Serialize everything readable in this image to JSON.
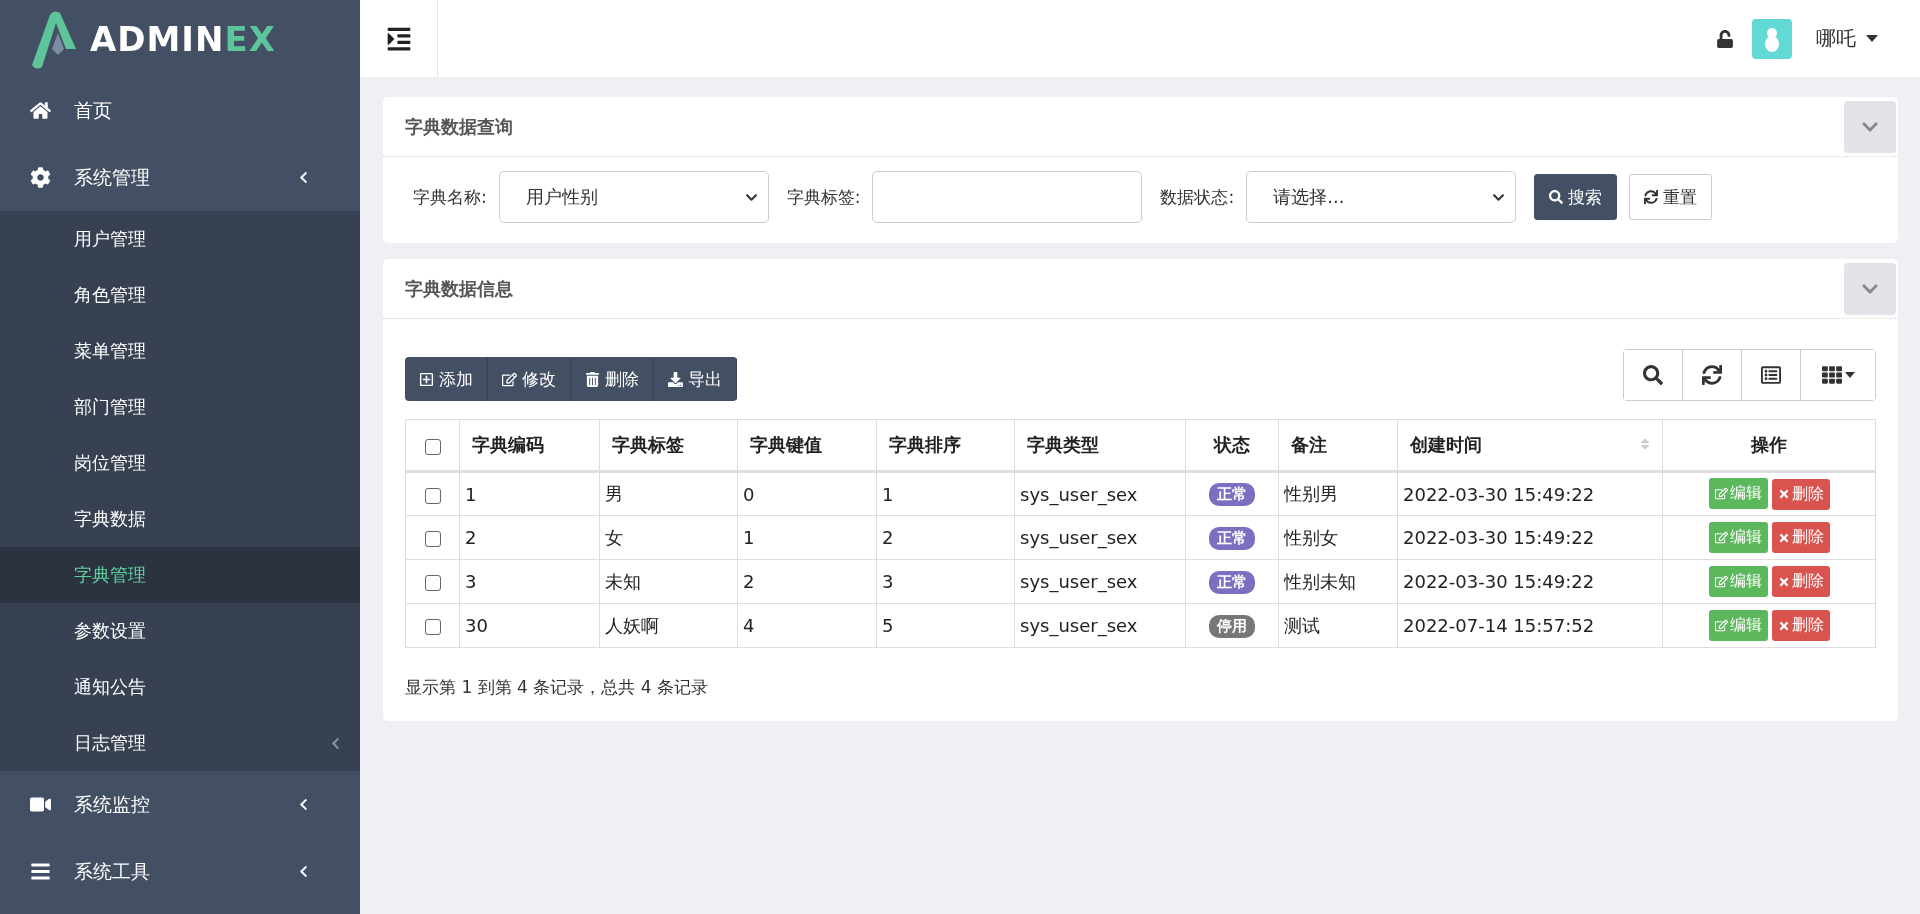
{
  "logo": {
    "main": "ADMIN",
    "accent": "EX"
  },
  "sidebar": {
    "items": [
      {
        "label": "首页",
        "kind": "link",
        "selected": false
      },
      {
        "label": "系统管理",
        "kind": "group",
        "selected": false,
        "children": [
          {
            "label": "用户管理",
            "kind": "link",
            "selected": false
          },
          {
            "label": "角色管理",
            "kind": "link",
            "selected": false
          },
          {
            "label": "菜单管理",
            "kind": "link",
            "selected": false
          },
          {
            "label": "部门管理",
            "kind": "link",
            "selected": false
          },
          {
            "label": "岗位管理",
            "kind": "link",
            "selected": false
          },
          {
            "label": "字典数据",
            "kind": "link",
            "selected": false
          },
          {
            "label": "字典管理",
            "kind": "link",
            "selected": true
          },
          {
            "label": "参数设置",
            "kind": "link",
            "selected": false
          },
          {
            "label": "通知公告",
            "kind": "link",
            "selected": false
          },
          {
            "label": "日志管理",
            "kind": "group",
            "selected": false
          }
        ]
      },
      {
        "label": "系统监控",
        "kind": "group",
        "selected": false
      },
      {
        "label": "系统工具",
        "kind": "group",
        "selected": false
      }
    ]
  },
  "header": {
    "user": "哪吒"
  },
  "query_panel": {
    "title": "字典数据查询",
    "fields": [
      {
        "label": "字典名称:",
        "kind": "select",
        "value": "用户性别"
      },
      {
        "label": "字典标签:",
        "kind": "text"
      },
      {
        "label": "数据状态:",
        "kind": "select",
        "value": "请选择..."
      }
    ],
    "buttons": [
      {
        "label": "搜索",
        "kind": "primary"
      },
      {
        "label": "重置",
        "kind": "default"
      }
    ]
  },
  "data_panel": {
    "title": "字典数据信息",
    "toolbar": [
      "添加",
      "修改",
      "删除",
      "导出"
    ],
    "table": {
      "columns": [
        {
          "label": "字典编码",
          "sortable": false
        },
        {
          "label": "字典标签",
          "sortable": false
        },
        {
          "label": "字典键值",
          "sortable": false
        },
        {
          "label": "字典排序",
          "sortable": false
        },
        {
          "label": "字典类型",
          "sortable": false
        },
        {
          "label": "状态",
          "sortable": false
        },
        {
          "label": "备注",
          "sortable": false
        },
        {
          "label": "创建时间",
          "sortable": true
        },
        {
          "label": "操作",
          "sortable": false
        }
      ],
      "all_checked": false,
      "rows": [
        {
          "checked": false,
          "code": "1",
          "label": "男",
          "value": "0",
          "sort": "1",
          "type": "sys_user_sex",
          "status": {
            "text": "正常",
            "color": "#7b6fc1"
          },
          "remark": "性别男",
          "created": "2022-03-30 15:49:22",
          "actions": [
            "编辑",
            "删除"
          ]
        },
        {
          "checked": false,
          "code": "2",
          "label": "女",
          "value": "1",
          "sort": "2",
          "type": "sys_user_sex",
          "status": {
            "text": "正常",
            "color": "#7b6fc1"
          },
          "remark": "性别女",
          "created": "2022-03-30 15:49:22",
          "actions": [
            "编辑",
            "删除"
          ]
        },
        {
          "checked": false,
          "code": "3",
          "label": "未知",
          "value": "2",
          "sort": "3",
          "type": "sys_user_sex",
          "status": {
            "text": "正常",
            "color": "#7b6fc1"
          },
          "remark": "性别未知",
          "created": "2022-03-30 15:49:22",
          "actions": [
            "编辑",
            "删除"
          ]
        },
        {
          "checked": false,
          "code": "30",
          "label": "人妖啊",
          "value": "4",
          "sort": "5",
          "type": "sys_user_sex",
          "status": {
            "text": "停用",
            "color": "#777777"
          },
          "remark": "测试",
          "created": "2022-07-14 15:57:52",
          "actions": [
            "编辑",
            "删除"
          ]
        }
      ]
    },
    "footer": "显示第 1 到第 4 条记录，总共 4 条记录"
  }
}
